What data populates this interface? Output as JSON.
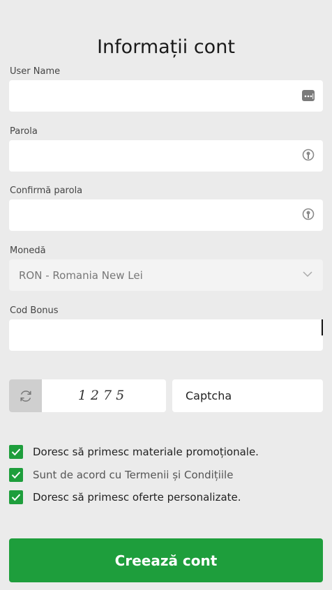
{
  "page": {
    "title": "Informații cont"
  },
  "form": {
    "username": {
      "label": "User Name",
      "value": "",
      "placeholder": ""
    },
    "password": {
      "label": "Parola",
      "value": "",
      "placeholder": ""
    },
    "confirm_password": {
      "label": "Confirmă parola",
      "value": "",
      "placeholder": ""
    },
    "currency": {
      "label": "Monedă",
      "selected": "RON - Romania New Lei"
    },
    "bonus_code": {
      "label": "Cod Bonus",
      "value": "",
      "placeholder": ""
    }
  },
  "captcha": {
    "code_image_text": "1275",
    "input_placeholder": "Captcha"
  },
  "checkboxes": [
    {
      "label": "Doresc să primesc materiale promoționale.",
      "checked": true
    },
    {
      "label": "Sunt de acord cu Termenii și Condițiile",
      "checked": true
    },
    {
      "label": "Doresc să primesc oferte personalizate.",
      "checked": true
    }
  ],
  "submit_label": "Creează cont",
  "colors": {
    "accent": "#1e9e3c",
    "background": "#ebebeb",
    "field": "#ffffff"
  }
}
